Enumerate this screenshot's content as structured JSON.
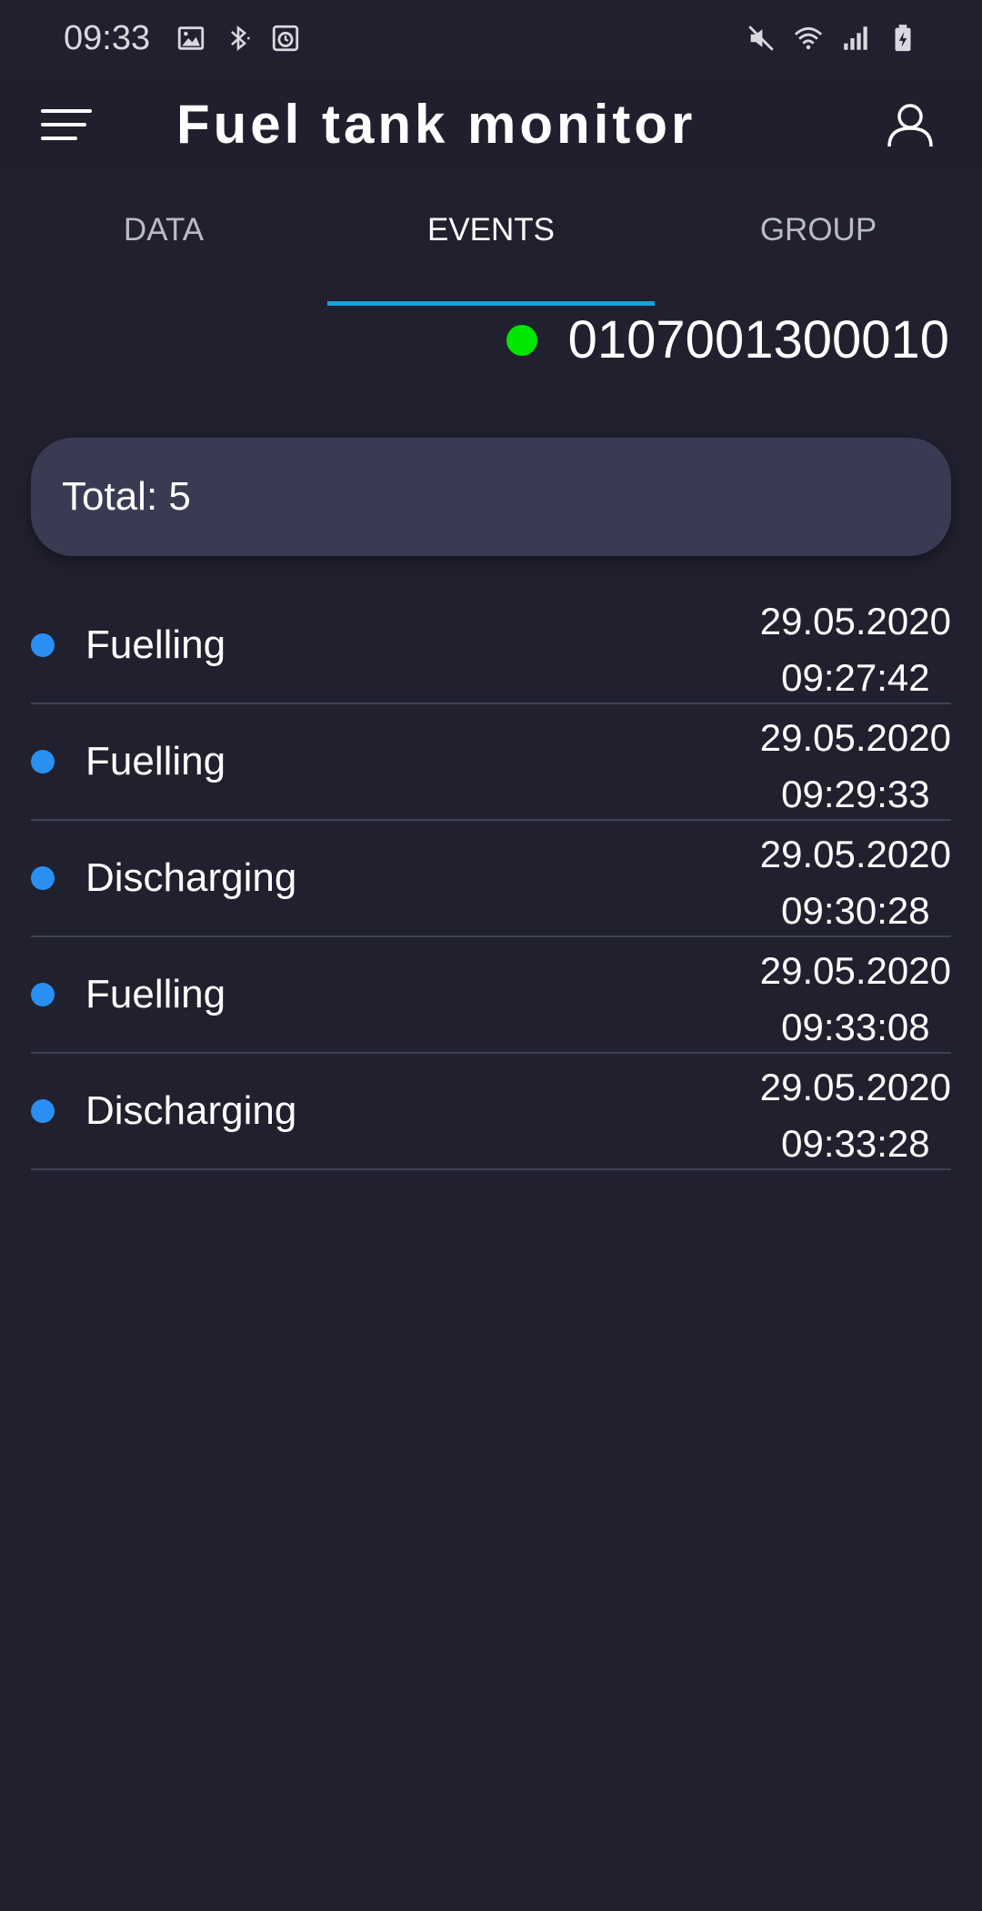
{
  "status_bar": {
    "time": "09:33",
    "left_icons": [
      "image-icon",
      "bluetooth-icon",
      "clock-box-icon"
    ],
    "right_icons": [
      "mute-icon",
      "wifi-icon",
      "signal-icon",
      "battery-charging-icon"
    ]
  },
  "app_bar": {
    "title": "Fuel tank monitor",
    "menu_icon": "menu-icon",
    "profile_icon": "person-icon"
  },
  "tabs": [
    {
      "label": "DATA",
      "active": false
    },
    {
      "label": "EVENTS",
      "active": true
    },
    {
      "label": "GROUP",
      "active": false
    }
  ],
  "device": {
    "id": "0107001300010",
    "status_color": "#00e600"
  },
  "summary": {
    "total_text": "Total: 5"
  },
  "events": [
    {
      "name": "Fuelling",
      "date": "29.05.2020",
      "time": "09:27:42"
    },
    {
      "name": "Fuelling",
      "date": "29.05.2020",
      "time": "09:29:33"
    },
    {
      "name": "Discharging",
      "date": "29.05.2020",
      "time": "09:30:28"
    },
    {
      "name": "Fuelling",
      "date": "29.05.2020",
      "time": "09:33:08"
    },
    {
      "name": "Discharging",
      "date": "29.05.2020",
      "time": "09:33:28"
    }
  ],
  "colors": {
    "background": "#20202f",
    "tab_indicator": "#1b9ed9",
    "card": "#3a3b53",
    "event_dot": "#2a8ff2"
  }
}
